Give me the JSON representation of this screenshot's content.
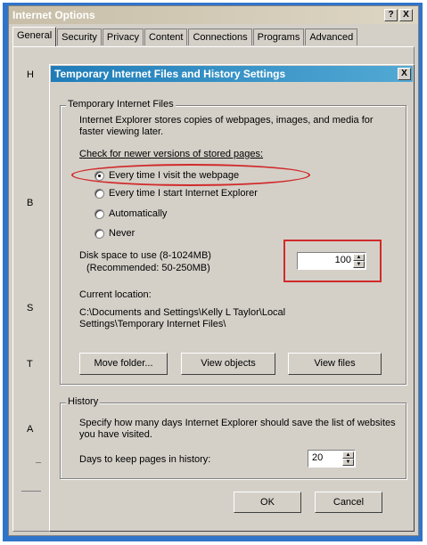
{
  "outer_window": {
    "title": "Internet Options",
    "help_label": "?",
    "close_label": "X",
    "tabs": [
      {
        "label": "General"
      },
      {
        "label": "Security"
      },
      {
        "label": "Privacy"
      },
      {
        "label": "Content"
      },
      {
        "label": "Connections"
      },
      {
        "label": "Programs"
      },
      {
        "label": "Advanced"
      }
    ],
    "side_letters": [
      "H",
      "B",
      "S",
      "T",
      "A"
    ]
  },
  "dialog": {
    "title": "Temporary Internet Files and History Settings",
    "close_label": "X",
    "temp_group": {
      "legend": "Temporary Internet Files",
      "description": "Internet Explorer stores copies of webpages, images, and media for faster viewing later.",
      "check_label": "Check for newer versions of stored pages:",
      "options": [
        {
          "label": "Every time I visit the webpage"
        },
        {
          "label": "Every time I start Internet Explorer"
        },
        {
          "label": "Automatically"
        },
        {
          "label": "Never"
        }
      ],
      "selected_option": "Every time I visit the webpage",
      "disk_label_1": "Disk space to use (8-1024MB)",
      "disk_label_2": "(Recommended: 50-250MB)",
      "disk_value": "100",
      "current_location_label": "Current location:",
      "current_location_1": "C:\\Documents and Settings\\Kelly L Taylor\\Local",
      "current_location_2": "Settings\\Temporary Internet Files\\",
      "move_folder": "Move folder...",
      "view_objects": "View objects",
      "view_files": "View files"
    },
    "history_group": {
      "legend": "History",
      "description": "Specify how many days Internet Explorer should save the list of websites you have visited.",
      "days_label": "Days to keep pages in history:",
      "days_value": "20"
    },
    "ok": "OK",
    "cancel": "Cancel"
  },
  "colors": {
    "frame_blue": "#2f74c9",
    "title_blue": "#1f7cb8",
    "highlight_red": "#d12a2a",
    "dialog_face": "#d4d0c8"
  }
}
